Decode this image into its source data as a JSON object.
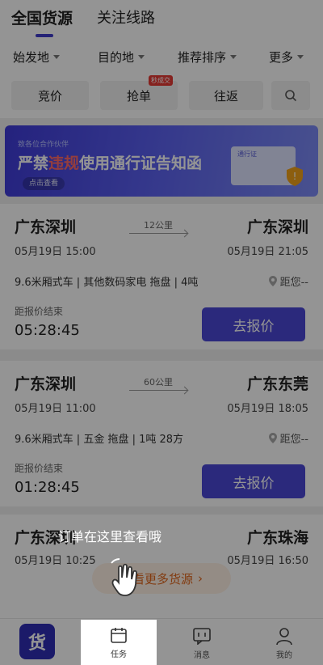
{
  "tabs": {
    "active": "全国货源",
    "other": "关注线路"
  },
  "filters": [
    {
      "label": "始发地"
    },
    {
      "label": "目的地"
    },
    {
      "label": "推荐排序"
    },
    {
      "label": "更多"
    }
  ],
  "quick": {
    "bid": "竞价",
    "grab": "抢单",
    "grab_badge": "秒成交",
    "roundtrip": "往返"
  },
  "banner": {
    "subtitle": "致各位合作伙伴",
    "title_pre": "严禁",
    "title_highlight": "违规",
    "title_post": "使用通行证告知函",
    "more": "点击查看",
    "pic_label": "通行证"
  },
  "cards": [
    {
      "from_city": "广东深圳",
      "to_city": "广东深圳",
      "distance": "12公里",
      "depart": "05月19日 15:00",
      "arrive": "05月19日 21:05",
      "spec": "9.6米厢式车 | 其他数码家电 拖盘 | 4吨",
      "distance_from_you": "距您--",
      "until_label": "距报价结束",
      "remaining": "05:28:45",
      "quote_button": "去报价"
    },
    {
      "from_city": "广东深圳",
      "to_city": "广东东莞",
      "distance": "60公里",
      "depart": "05月19日 11:00",
      "arrive": "05月19日 18:05",
      "spec": "9.6米厢式车 | 五金 拖盘 | 1吨 28方",
      "distance_from_you": "距您--",
      "until_label": "距报价结束",
      "remaining": "01:28:45",
      "quote_button": "去报价"
    }
  ],
  "card3": {
    "from_city": "广东深圳",
    "to_city": "广东珠海",
    "depart": "05月19日 10:25",
    "arrive": "05月19日 16:50",
    "more_button": "查看更多货源"
  },
  "nav": {
    "logo": "货",
    "tasks": "任务",
    "messages": "消息",
    "mine": "我的"
  },
  "tip": "订单在这里查看哦"
}
